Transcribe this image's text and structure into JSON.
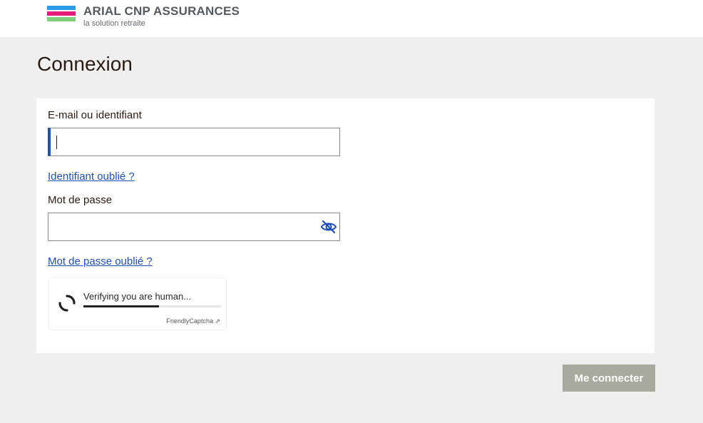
{
  "header": {
    "brand_name": "ARIAL CNP ASSURANCES",
    "tagline": "la solution retraite",
    "logo_colors": [
      "#2c9be6",
      "#e6197d",
      "#7fcf7a"
    ]
  },
  "page": {
    "title": "Connexion"
  },
  "form": {
    "login_label": "E-mail ou identifiant",
    "login_value": "",
    "forgot_login_link": "Identifiant oublié ?",
    "password_label": "Mot de passe",
    "password_value": "",
    "password_toggle_icon": "eye-slash-icon",
    "forgot_password_link": "Mot de passe oublié ?"
  },
  "captcha": {
    "status_text": "Verifying you are human...",
    "progress": 0.55,
    "brand": "FriendlyCaptcha ⇗"
  },
  "actions": {
    "submit_label": "Me connecter"
  },
  "colors": {
    "accent": "#1c4fb8",
    "button_disabled": "#a9aa9e",
    "page_bg": "#efefef"
  }
}
